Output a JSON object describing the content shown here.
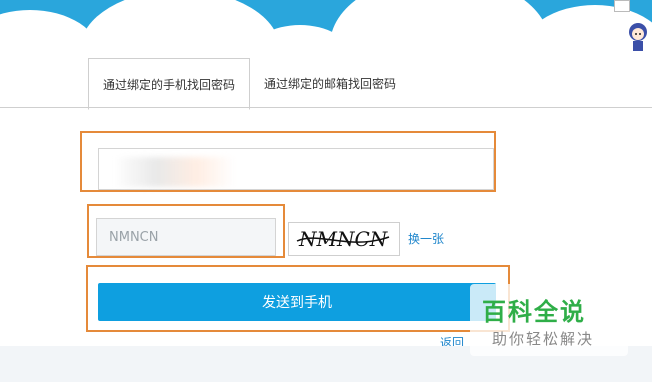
{
  "tabs": [
    {
      "label": "通过绑定的手机找回密码",
      "active": true
    },
    {
      "label": "通过绑定的邮箱找回密码",
      "active": false
    }
  ],
  "form": {
    "phone_value": "",
    "code_value": "NMNCN",
    "captcha_text": "NMNCN",
    "refresh_label": "换一张",
    "send_label": "发送到手机",
    "back_label": "返回"
  },
  "watermark": {
    "logo": "百科全说",
    "slogan": "助你轻松解决"
  },
  "colors": {
    "accent": "#0e9fe0",
    "link": "#1f86cc",
    "highlight": "#e58a3a",
    "header": "#2aa6dc"
  }
}
